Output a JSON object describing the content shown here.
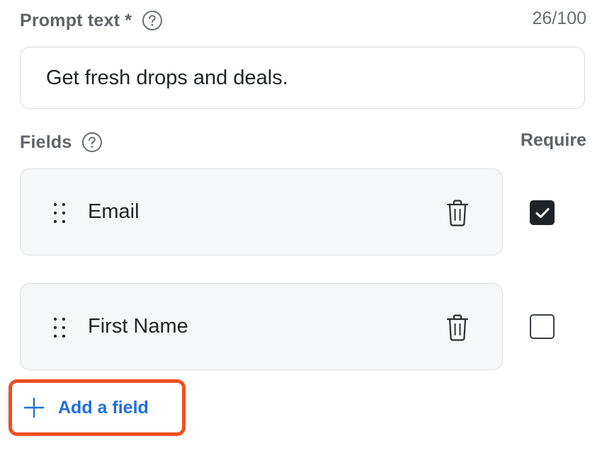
{
  "prompt": {
    "label": "Prompt text *",
    "counter": "26/100",
    "value": "Get fresh drops and deals.",
    "help_icon": "question-circle-icon"
  },
  "fields_section": {
    "label": "Fields",
    "require_label": "Require",
    "help_icon": "question-circle-icon",
    "items": [
      {
        "name": "Email",
        "required": true
      },
      {
        "name": "First Name",
        "required": false
      }
    ]
  },
  "add_field": {
    "label": "Add a field",
    "icon": "plus-icon"
  },
  "colors": {
    "accent": "#1f6fdb",
    "highlight": "#f0501e",
    "checkbox_checked": "#1f2328",
    "label_gray": "#5f6368"
  }
}
